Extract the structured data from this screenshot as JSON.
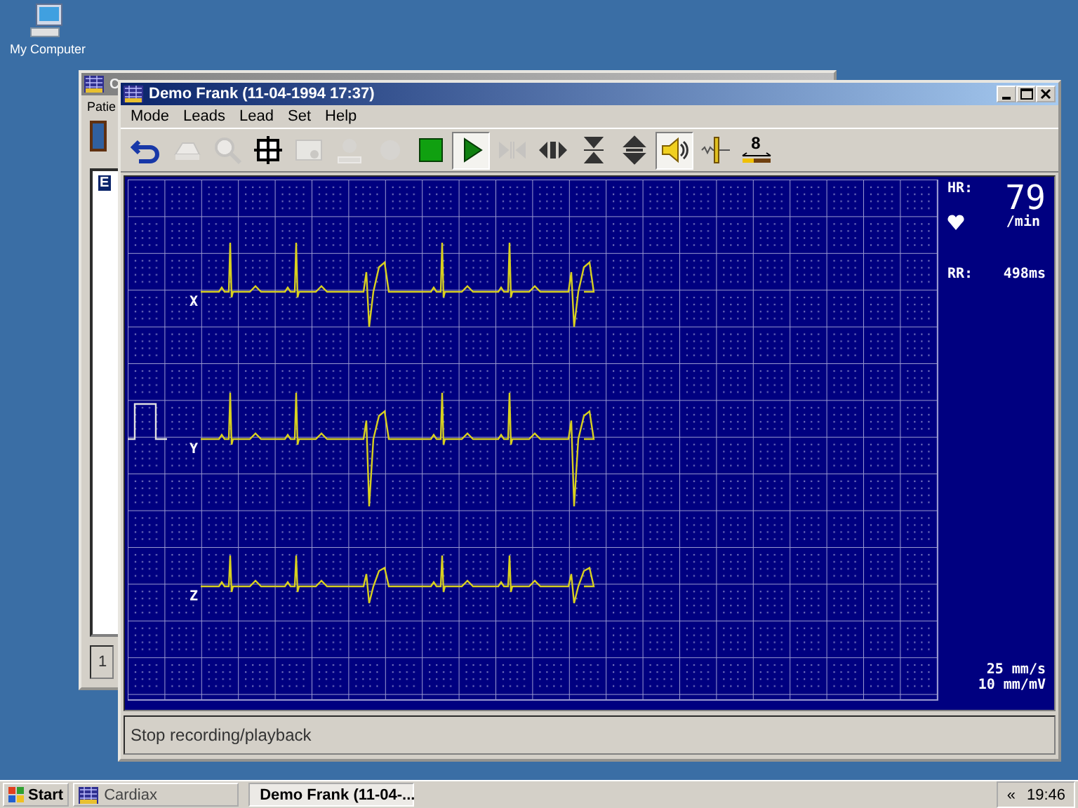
{
  "desktop": {
    "icons": [
      {
        "label": "My Computer"
      }
    ]
  },
  "background_window": {
    "title": "C",
    "menu": [
      "Patie"
    ],
    "list": [
      {
        "label": "E",
        "selected": true
      }
    ],
    "field": "1"
  },
  "window": {
    "title": "Demo Frank (11-04-1994 17:37)"
  },
  "menu": [
    "Mode",
    "Leads",
    "Lead",
    "Set",
    "Help"
  ],
  "toolbar": [
    {
      "kind": "undo",
      "pressed": false,
      "disabled": false
    },
    {
      "kind": "printer",
      "pressed": false,
      "disabled": true
    },
    {
      "kind": "zoom",
      "pressed": false,
      "disabled": true
    },
    {
      "kind": "grid",
      "pressed": false,
      "disabled": false
    },
    {
      "kind": "image",
      "pressed": false,
      "disabled": true
    },
    {
      "kind": "person",
      "pressed": false,
      "disabled": true
    },
    {
      "kind": "record",
      "pressed": false,
      "disabled": true
    },
    {
      "kind": "stop",
      "pressed": false,
      "disabled": false
    },
    {
      "kind": "play",
      "pressed": true,
      "disabled": false
    },
    {
      "kind": "step",
      "pressed": false,
      "disabled": true
    },
    {
      "kind": "scroll",
      "pressed": false,
      "disabled": false
    },
    {
      "kind": "compress",
      "pressed": false,
      "disabled": false
    },
    {
      "kind": "expand",
      "pressed": false,
      "disabled": false
    },
    {
      "kind": "sound",
      "pressed": true,
      "disabled": false
    },
    {
      "kind": "filter",
      "pressed": false,
      "disabled": false
    },
    {
      "kind": "speed",
      "label": "8",
      "pressed": false,
      "disabled": false
    }
  ],
  "ecg": {
    "leads": [
      {
        "label": "X",
        "calibration": false
      },
      {
        "label": "Y",
        "calibration": true
      },
      {
        "label": "Z",
        "calibration": false
      }
    ]
  },
  "vitals": {
    "hr_label": "HR:",
    "hr_value": "79",
    "hr_unit": "/min",
    "rr_label": "RR:",
    "rr_value": "498ms",
    "speed": "25 mm/s",
    "gain": "10 mm/mV"
  },
  "status_bar": "Stop recording/playback",
  "taskbar": {
    "start": "Start",
    "tasks": [
      {
        "label": "Cardiax",
        "selected": false
      },
      {
        "label": "Demo Frank (11-04-...",
        "selected": true
      }
    ],
    "tray": {
      "expand": "«",
      "time": "19:46"
    }
  }
}
